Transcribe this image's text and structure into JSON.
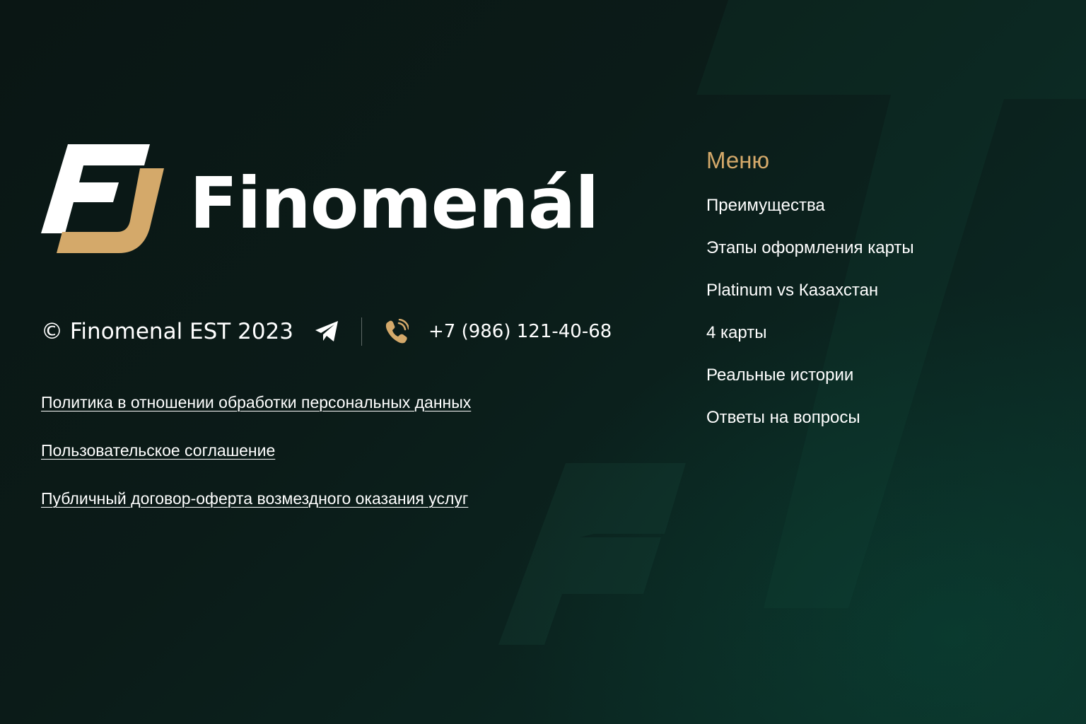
{
  "brand": {
    "name": "Finomenál",
    "accent_color": "#d4a96a",
    "logo_icon": "fj-monogram-icon"
  },
  "contact": {
    "copyright": "© Finomenal EST 2023",
    "telegram_icon": "telegram-icon",
    "phone_icon": "phone-icon",
    "phone": "+7 (986) 121-40-68"
  },
  "legal": {
    "links": [
      "Политика в отношении обработки персональных данных",
      "Пользовательское соглашение",
      "Публичный договор-оферта возмездного оказания услуг"
    ]
  },
  "menu": {
    "title": "Меню",
    "items": [
      "Преимущества",
      "Этапы оформления карты",
      "Platinum vs Казахстан",
      "4 карты",
      "Реальные истории",
      "Ответы на вопросы"
    ]
  }
}
